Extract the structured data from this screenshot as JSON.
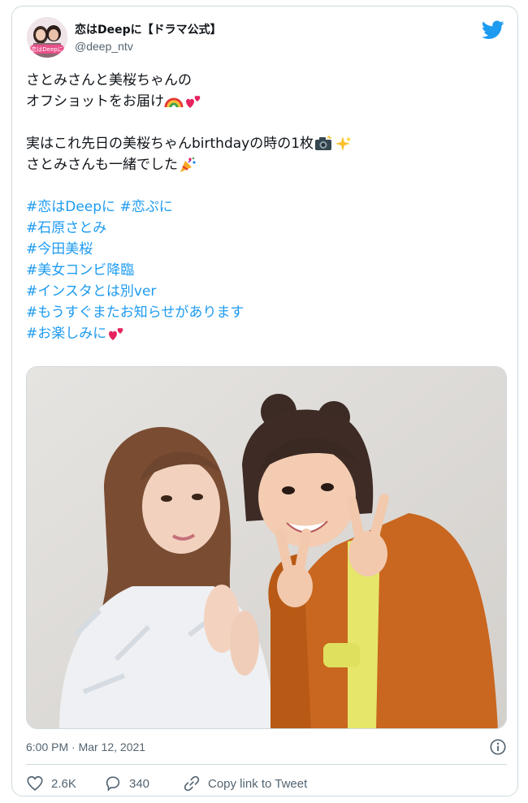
{
  "author": {
    "display_name": "恋はDeepに【ドラマ公式】",
    "handle": "@deep_ntv",
    "avatar_text": "恋はDeepに"
  },
  "tweet": {
    "line1": "さとみさんと美桜ちゃんの",
    "line2": "オフショットをお届け",
    "line3": "実はこれ先日の美桜ちゃんbirthdayの時の1枚",
    "line4": "さとみさんも一緒でした",
    "hashtags": [
      "#恋はDeepに #恋ぷに",
      "#石原さとみ",
      "#今田美桜",
      "#美女コンビ降臨",
      "#インスタとは別ver",
      "#もうすぐまたお知らせがあります",
      "#お楽しみに"
    ]
  },
  "meta": {
    "timestamp": "6:00 PM · Mar 12, 2021"
  },
  "actions": {
    "likes": "2.6K",
    "replies": "340",
    "copy_link": "Copy link to Tweet"
  },
  "icons": {
    "logo": "twitter-bird-icon",
    "info": "info-icon",
    "like": "heart-icon",
    "reply": "reply-bubble-icon",
    "copy": "link-icon"
  },
  "colors": {
    "brand": "#1d9bf0",
    "text": "#0f1419",
    "muted": "#536471",
    "border": "#cfd9de"
  }
}
